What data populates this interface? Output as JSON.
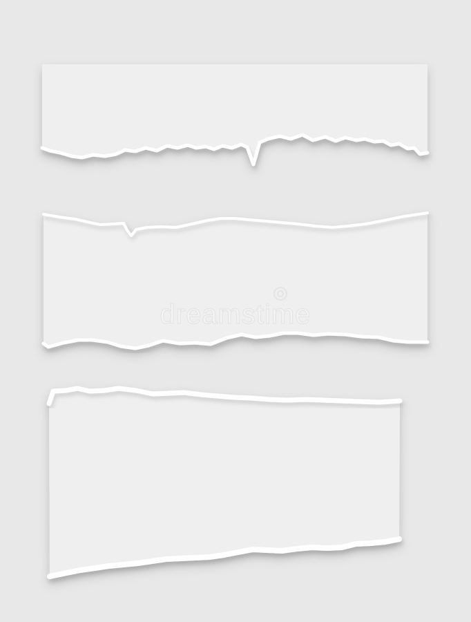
{
  "colors": {
    "background": "#e8e8e8",
    "paper": "#efefef",
    "torn_edge": "#ffffff",
    "shadow": "#000000"
  },
  "watermark": {
    "text": "dreamstime"
  }
}
